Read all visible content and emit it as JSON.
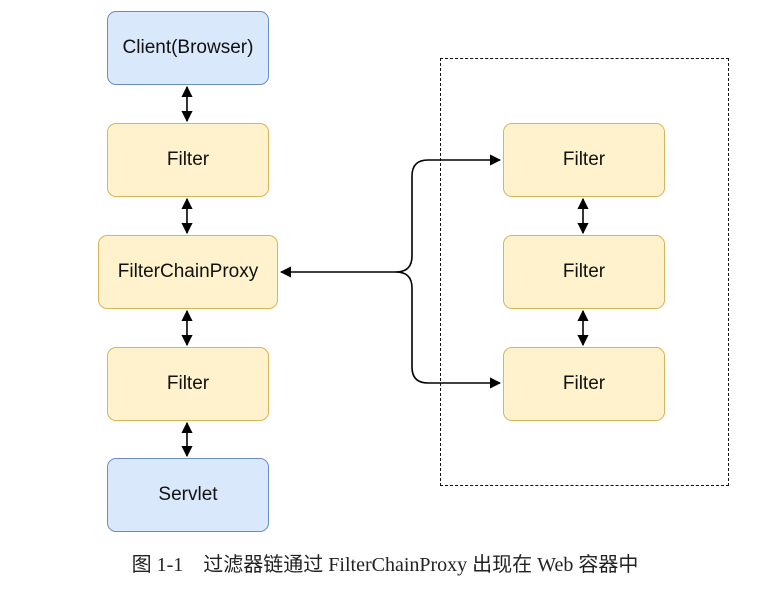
{
  "left_chain": [
    {
      "label": "Client(Browser)",
      "style": "blue"
    },
    {
      "label": "Filter",
      "style": "yellow"
    },
    {
      "label": "FilterChainProxy",
      "style": "yellow"
    },
    {
      "label": "Filter",
      "style": "yellow"
    },
    {
      "label": "Servlet",
      "style": "blue"
    }
  ],
  "right_chain": [
    {
      "label": "Filter",
      "style": "yellow"
    },
    {
      "label": "Filter",
      "style": "yellow"
    },
    {
      "label": "Filter",
      "style": "yellow"
    }
  ],
  "caption": "图 1-1　过滤器链通过 FilterChainProxy 出现在 Web 容器中",
  "colors": {
    "blue_fill": "#dae8fc",
    "blue_stroke": "#6c8ebf",
    "yellow_fill": "#fff2cc",
    "yellow_stroke": "#d6b656"
  }
}
